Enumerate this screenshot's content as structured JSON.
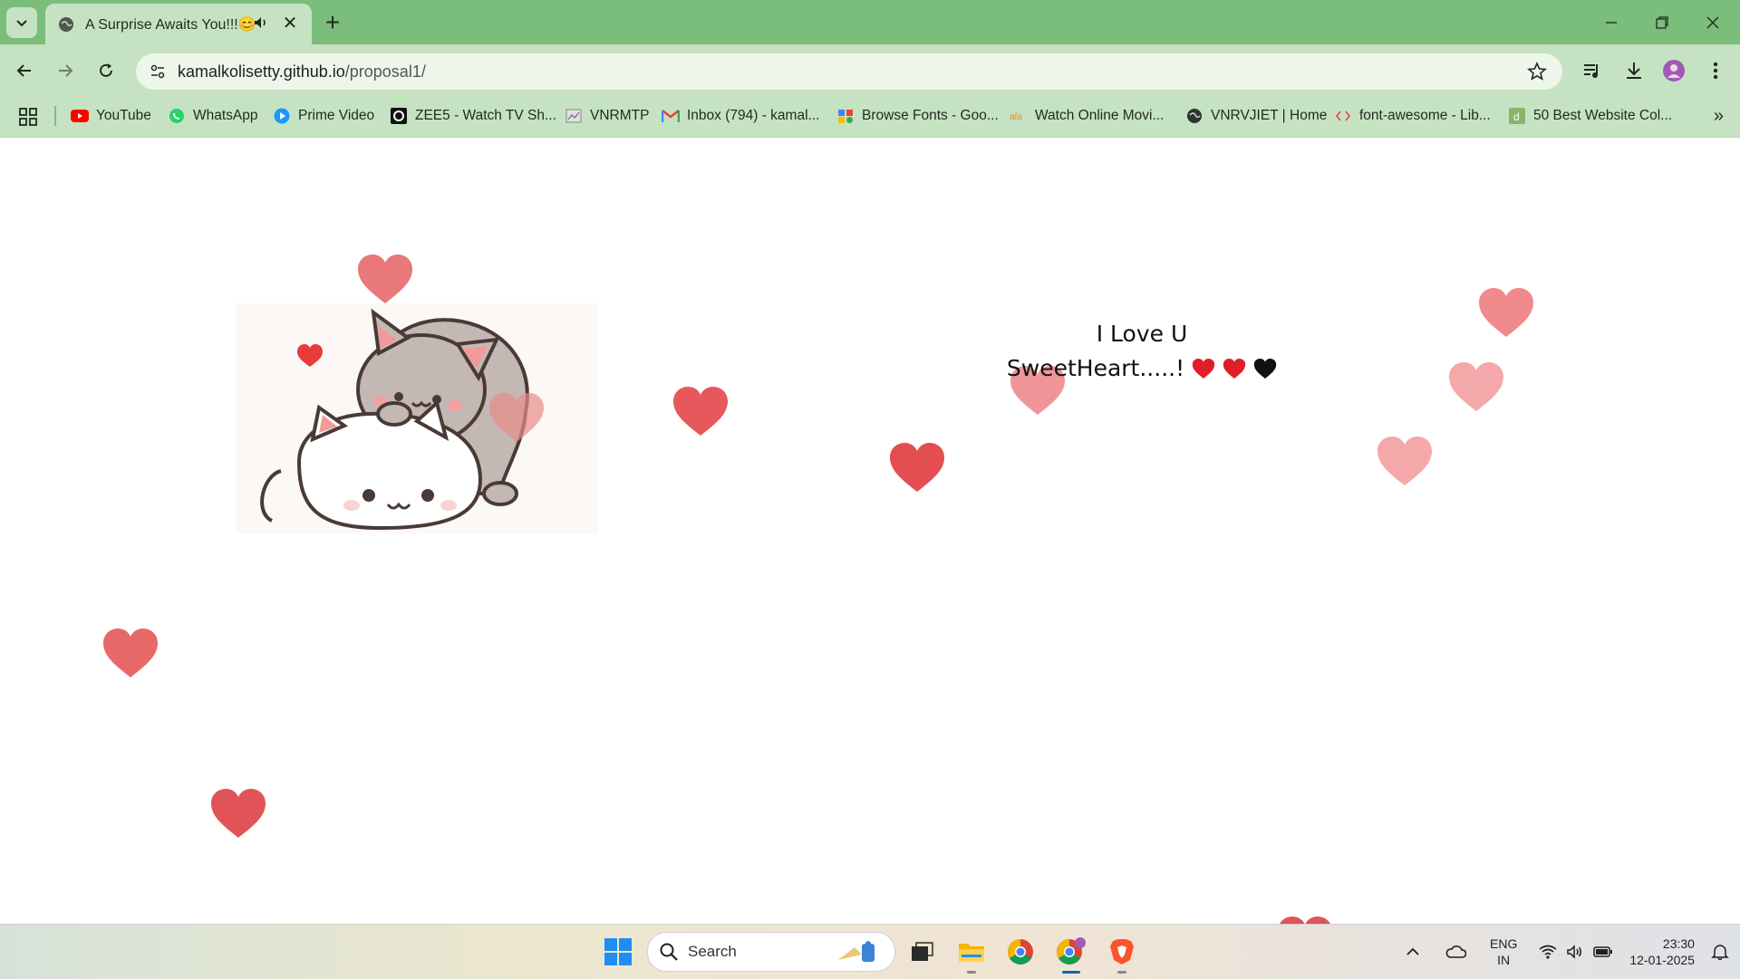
{
  "browser": {
    "tab_title": "A Surprise Awaits You!!!😊",
    "url_host": "kamalkolisetty.github.io",
    "url_path": "/proposal1/"
  },
  "bookmarks": [
    {
      "label": "YouTube",
      "icon": "youtube-icon"
    },
    {
      "label": "WhatsApp",
      "icon": "whatsapp-icon"
    },
    {
      "label": "Prime Video",
      "icon": "prime-video-icon"
    },
    {
      "label": "ZEE5 - Watch TV Sh...",
      "icon": "zee5-icon"
    },
    {
      "label": "VNRMTP",
      "icon": "vnrmtp-icon"
    },
    {
      "label": "Inbox (794) - kamal...",
      "icon": "gmail-icon"
    },
    {
      "label": "Browse Fonts - Goo...",
      "icon": "google-fonts-icon"
    },
    {
      "label": "Watch Online Movi...",
      "icon": "movies-icon"
    },
    {
      "label": "VNRVJIET | Home",
      "icon": "globe-icon"
    },
    {
      "label": "font-awesome - Lib...",
      "icon": "code-icon"
    },
    {
      "label": "50 Best Website Col...",
      "icon": "bookmark-page-icon"
    }
  ],
  "page": {
    "message_line1": "I Love U",
    "message_line2": "SweetHeart.....!",
    "accent_colors": {
      "heart": "#e8686a",
      "heart_light": "#f0a1a4"
    }
  },
  "taskbar": {
    "search_label": "Search",
    "lang_line1": "ENG",
    "lang_line2": "IN",
    "time": "23:30",
    "date": "12-01-2025"
  }
}
